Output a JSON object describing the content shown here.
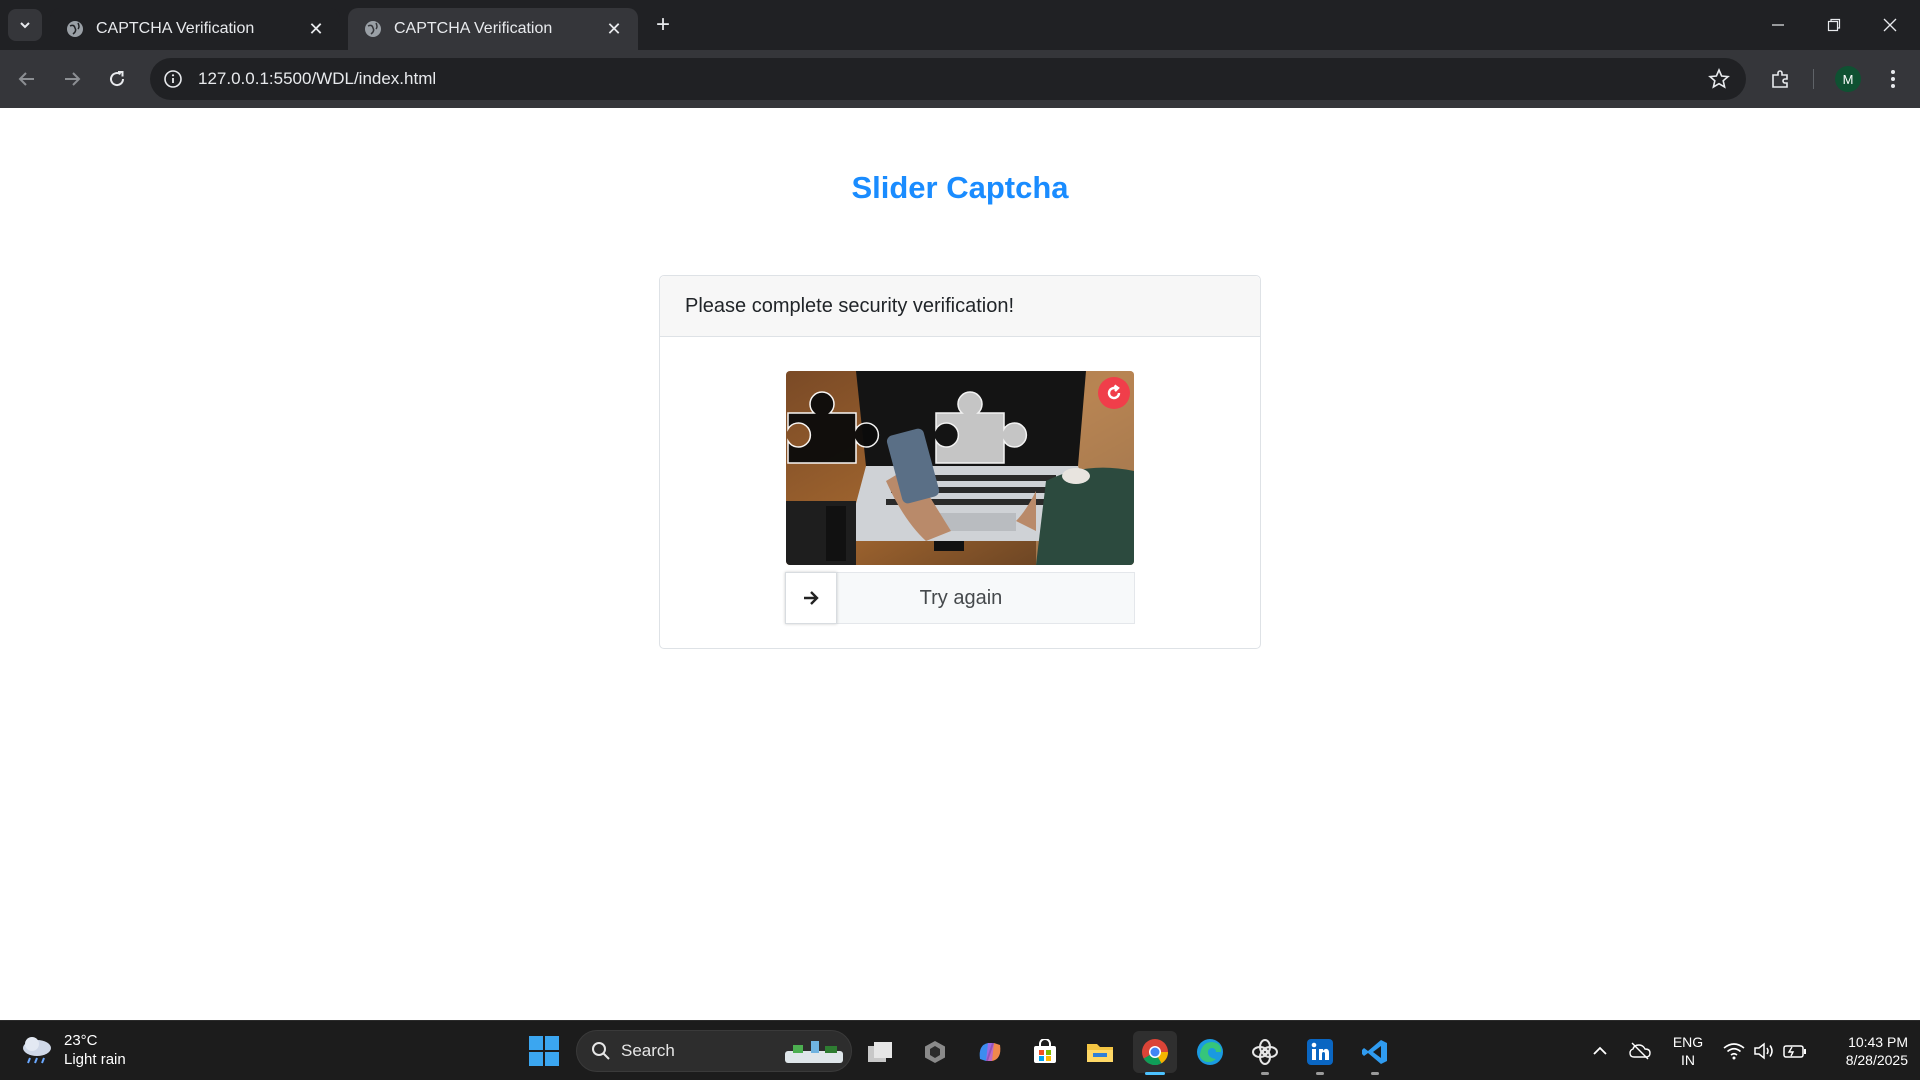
{
  "browser": {
    "tabs": [
      {
        "title": "CAPTCHA Verification",
        "active": false
      },
      {
        "title": "CAPTCHA Verification",
        "active": true
      }
    ],
    "url": "127.0.0.1:5500/WDL/index.html",
    "profile_initial": "M"
  },
  "page": {
    "title": "Slider Captcha",
    "card_header": "Please complete security verification!",
    "slider_label": "Try again",
    "accent_color": "#1a8cff",
    "refresh_color": "#f03e4a"
  },
  "taskbar": {
    "weather": {
      "temp": "23°C",
      "condition": "Light rain"
    },
    "search_placeholder": "Search",
    "apps": [
      "task-view",
      "app-generic",
      "copilot",
      "microsoft-store",
      "file-explorer",
      "chrome",
      "edge",
      "chatgpt",
      "linkedin",
      "vscode"
    ],
    "language": {
      "line1": "ENG",
      "line2": "IN"
    },
    "time": "10:43 PM",
    "date": "8/28/2025"
  }
}
